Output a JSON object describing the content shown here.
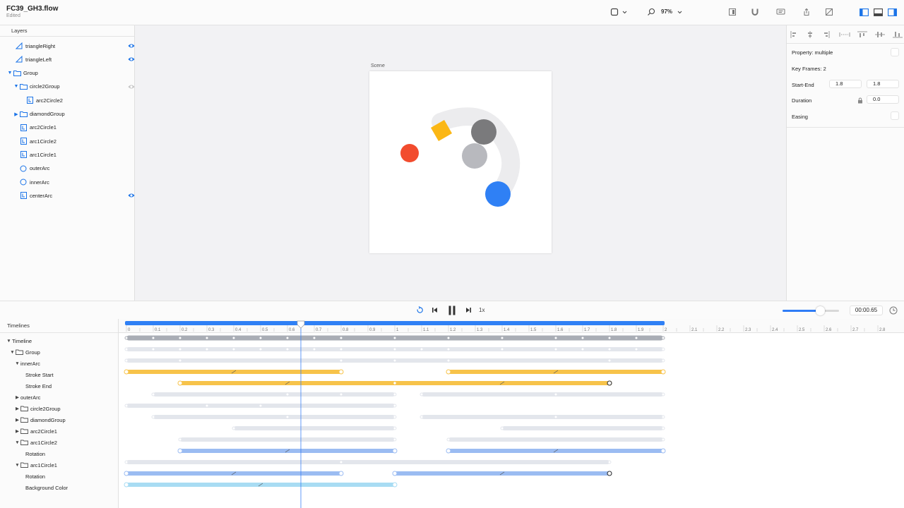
{
  "document": {
    "title": "FC39_GH3.flow",
    "status": "Edited"
  },
  "toolbar": {
    "zoom": "97%",
    "icons": [
      "shape-tool-icon",
      "search-zoom-icon",
      "panel-icon",
      "magnet-icon",
      "comment-icon",
      "share-icon",
      "export-icon",
      "left-sidebar-icon",
      "bottom-panel-icon",
      "right-sidebar-icon"
    ]
  },
  "layers": {
    "header": "Layers",
    "items": [
      {
        "label": "triangleRight",
        "indent": 0,
        "icon": "triangle",
        "expand": "",
        "eye": true
      },
      {
        "label": "triangleLeft",
        "indent": 0,
        "icon": "triangle",
        "expand": "",
        "eye": true
      },
      {
        "label": "Group",
        "indent": -1,
        "icon": "folder",
        "expand": "open",
        "eye": false
      },
      {
        "label": "circle2Group",
        "indent": 1,
        "icon": "folder",
        "expand": "open",
        "eye": "dim"
      },
      {
        "label": "arc2Circle2",
        "indent": 2,
        "icon": "image",
        "expand": "",
        "eye": false
      },
      {
        "label": "diamondGroup",
        "indent": 1,
        "icon": "folder",
        "expand": "closed",
        "eye": false
      },
      {
        "label": "arc2Circle1",
        "indent": 1,
        "icon": "image",
        "expand": "",
        "eye": false
      },
      {
        "label": "arc1Circle2",
        "indent": 1,
        "icon": "image",
        "expand": "",
        "eye": false
      },
      {
        "label": "arc1Circle1",
        "indent": 1,
        "icon": "image",
        "expand": "",
        "eye": false
      },
      {
        "label": "outerArc",
        "indent": 1,
        "icon": "circle",
        "expand": "",
        "eye": false
      },
      {
        "label": "innerArc",
        "indent": 1,
        "icon": "circle",
        "expand": "",
        "eye": false
      },
      {
        "label": "centerArc",
        "indent": 1,
        "icon": "image",
        "expand": "",
        "eye": true
      }
    ]
  },
  "scene": {
    "label": "Scene",
    "colors": {
      "red": "#f24c2e",
      "yellow": "#fbb715",
      "dark_gray": "#7a7a7c",
      "light_gray": "#b8b9be",
      "blue": "#2f80f5",
      "arc": "#ececee"
    }
  },
  "inspector": {
    "property_label": "Property: multiple",
    "keyframes_label": "Key Frames: 2",
    "start_end_label": "Start-End",
    "start_value": "1.8",
    "end_value": "1.8",
    "duration_label": "Duration",
    "duration_value": "0.0",
    "easing_label": "Easing"
  },
  "transport": {
    "speed": "1x",
    "time": "00:00.65",
    "volume": 0.66
  },
  "timelines": {
    "header": "Timelines",
    "rows": [
      {
        "label": "Timeline",
        "tri": "down",
        "folder": false,
        "level": 0,
        "bold": true
      },
      {
        "label": "Group",
        "tri": "down",
        "folder": true,
        "level": 1,
        "bold": false
      },
      {
        "label": "innerArc",
        "tri": "down",
        "folder": false,
        "level": 2,
        "bold": false
      },
      {
        "label": "Stroke Start",
        "tri": "",
        "folder": false,
        "level": 3,
        "bold": false
      },
      {
        "label": "Stroke End",
        "tri": "",
        "folder": false,
        "level": 3,
        "bold": false
      },
      {
        "label": "outerArc",
        "tri": "right",
        "folder": false,
        "level": 2,
        "bold": false
      },
      {
        "label": "circle2Group",
        "tri": "right",
        "folder": true,
        "level": 2,
        "bold": false
      },
      {
        "label": "diamondGroup",
        "tri": "right",
        "folder": true,
        "level": 2,
        "bold": false
      },
      {
        "label": "arc2Circle1",
        "tri": "right",
        "folder": true,
        "level": 2,
        "bold": false
      },
      {
        "label": "arc1Circle2",
        "tri": "down",
        "folder": true,
        "level": 2,
        "bold": false
      },
      {
        "label": "Rotation",
        "tri": "",
        "folder": false,
        "level": 3,
        "bold": false
      },
      {
        "label": "arc1Circle1",
        "tri": "down",
        "folder": true,
        "level": 2,
        "bold": false
      },
      {
        "label": "Rotation",
        "tri": "",
        "folder": false,
        "level": 3,
        "bold": false
      },
      {
        "label": "Background Color",
        "tri": "",
        "folder": false,
        "level": 3,
        "bold": false
      }
    ],
    "ruler_labels": [
      "0",
      "0.1",
      "0.2",
      "0.3",
      "0.4",
      "0.5",
      "0.6",
      "0.7",
      "0.8",
      "0.9",
      "1",
      "1.1",
      "1.2",
      "1.3",
      "1.4",
      "1.5",
      "1.6",
      "1.7",
      "1.8",
      "1.9",
      "2",
      "2.1",
      "2.2",
      "2.3",
      "2.4",
      "2.5",
      "2.6",
      "2.7",
      "2.8"
    ],
    "duration": 2,
    "playhead_time": 0.65,
    "tracks": [
      {
        "row": 0,
        "kind": "master",
        "segments": [
          [
            0,
            2
          ]
        ],
        "keys": [
          0,
          0.1,
          0.2,
          0.3,
          0.4,
          0.5,
          0.6,
          0.7,
          0.8,
          1,
          1.2,
          1.4,
          1.6,
          1.7,
          1.8,
          1.9,
          2
        ]
      },
      {
        "row": 1,
        "kind": "group",
        "segments": [
          [
            0,
            2
          ]
        ],
        "keys": [
          0,
          0.1,
          0.2,
          0.3,
          0.4,
          0.5,
          0.6,
          0.7,
          0.8,
          1,
          1.1,
          1.2,
          1.4,
          1.6,
          1.7,
          1.8,
          1.9,
          2
        ]
      },
      {
        "row": 2,
        "kind": "group",
        "segments": [
          [
            0,
            2
          ]
        ],
        "keys": [
          0,
          0.2,
          0.8,
          1,
          1.2,
          1.8,
          2
        ]
      },
      {
        "row": 3,
        "kind": "yellow",
        "segments": [
          [
            0,
            0.8
          ],
          [
            1.2,
            2
          ]
        ],
        "keys": [
          0,
          0.8,
          1.2,
          2
        ],
        "ease": [
          0.4,
          1.6
        ]
      },
      {
        "row": 4,
        "kind": "yellow",
        "segments": [
          [
            0.2,
            1.8
          ]
        ],
        "keys": [
          0.2,
          1,
          1.8
        ],
        "ease": [
          0.6,
          1.4
        ]
      },
      {
        "row": 5,
        "kind": "group",
        "segments": [
          [
            0.1,
            1
          ],
          [
            1.1,
            2
          ]
        ],
        "keys": [
          0.1,
          0.6,
          0.8,
          1,
          1.1,
          1.6,
          2
        ]
      },
      {
        "row": 6,
        "kind": "group",
        "segments": [
          [
            0,
            1
          ]
        ],
        "keys": [
          0,
          0.3,
          0.5,
          1
        ]
      },
      {
        "row": 7,
        "kind": "group",
        "segments": [
          [
            0.1,
            1
          ],
          [
            1.1,
            2
          ]
        ],
        "keys": [
          0.1,
          0.6,
          1,
          1.1,
          1.6,
          2
        ]
      },
      {
        "row": 8,
        "kind": "group",
        "segments": [
          [
            0.4,
            1
          ],
          [
            1.4,
            2
          ]
        ],
        "keys": [
          0.4,
          1,
          1.4,
          2
        ]
      },
      {
        "row": 9,
        "kind": "group",
        "segments": [
          [
            0.2,
            1
          ],
          [
            1.2,
            2
          ]
        ],
        "keys": [
          0.2,
          1,
          1.2,
          2
        ]
      },
      {
        "row": 10,
        "kind": "blue",
        "segments": [
          [
            0.2,
            1
          ],
          [
            1.2,
            2
          ]
        ],
        "keys": [
          0.2,
          1,
          1.2,
          2
        ],
        "ease": [
          0.6,
          1.6
        ]
      },
      {
        "row": 11,
        "kind": "group",
        "segments": [
          [
            0,
            1.8
          ]
        ],
        "keys": [
          0,
          0.8,
          1.8
        ]
      },
      {
        "row": 12,
        "kind": "blue",
        "segments": [
          [
            0,
            0.8
          ],
          [
            1,
            1.8
          ]
        ],
        "keys": [
          0,
          0.8,
          1,
          1.8
        ],
        "ease": [
          0.4,
          1.4
        ]
      },
      {
        "row": 13,
        "kind": "cyan",
        "segments": [
          [
            0,
            1
          ]
        ],
        "keys": [
          0,
          1
        ],
        "ease": [
          0.5
        ]
      }
    ]
  }
}
